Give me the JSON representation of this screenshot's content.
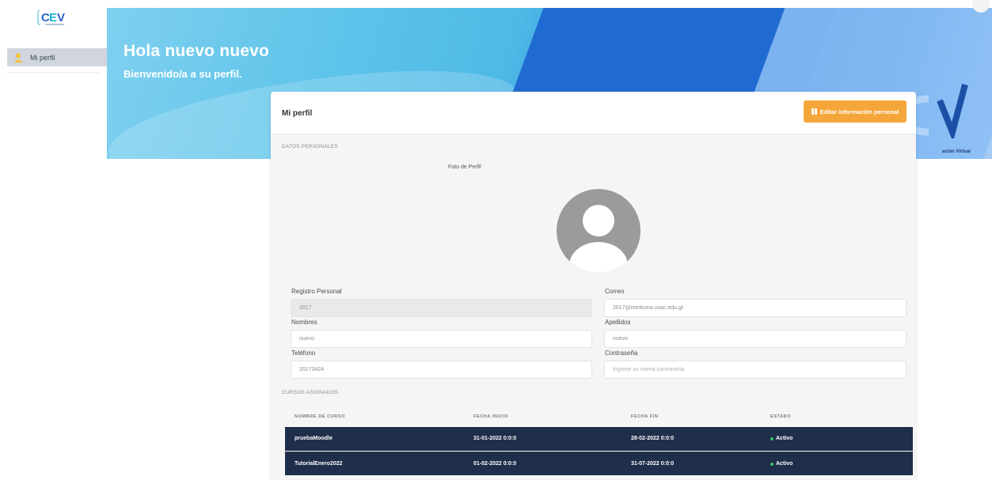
{
  "sidebar": {
    "nav": [
      {
        "label": "Mi perfil"
      }
    ]
  },
  "banner": {
    "greeting": "Hola nuevo nuevo",
    "welcome": "Bienvenido/a a su perfil.",
    "brand_tagline": "ación Virtual"
  },
  "card": {
    "title": "Mi perfil",
    "edit_button": "Editar información personal",
    "section_personal": "DATOS PERSONALES",
    "photo_label": "Foto de Perfil",
    "fields": {
      "registro": {
        "label": "Registro Personal",
        "value": "2017"
      },
      "correo": {
        "label": "Correo",
        "value": "2017@medicina.usac.edu.gt"
      },
      "nombres": {
        "label": "Nombres",
        "value": "nuevo"
      },
      "apellidos": {
        "label": "Apellidos",
        "value": "nuevo"
      },
      "telefono": {
        "label": "Teléfono",
        "value": "20173424"
      },
      "contrasena": {
        "label": "Contraseña",
        "placeholder": "Ingrese su nueva contraseña"
      }
    },
    "section_courses": "CURSOS ASIGNADOS",
    "table": {
      "headers": [
        "NOMBRE DE CURSO",
        "FECHA INICIO",
        "FECHA FIN",
        "ESTADO"
      ],
      "rows": [
        [
          "pruebaMoodle",
          "31-01-2022 0:0:0",
          "28-02-2022 0:0:0",
          "Activo"
        ],
        [
          "TutorialEnero2022",
          "01-02-2022 0:0:0",
          "31-07-2022 0:0:0",
          "Activo"
        ]
      ]
    }
  },
  "colors": {
    "accent_orange": "#f5a63a",
    "table_dark": "#1f2e4a",
    "status_active": "#3cc26b",
    "banner_blue": "#1f6bd1"
  },
  "icons": {
    "logo": "cev-logo",
    "nav_profile": "user-icon",
    "edit": "book-icon",
    "avatar": "avatar-placeholder-icon"
  }
}
